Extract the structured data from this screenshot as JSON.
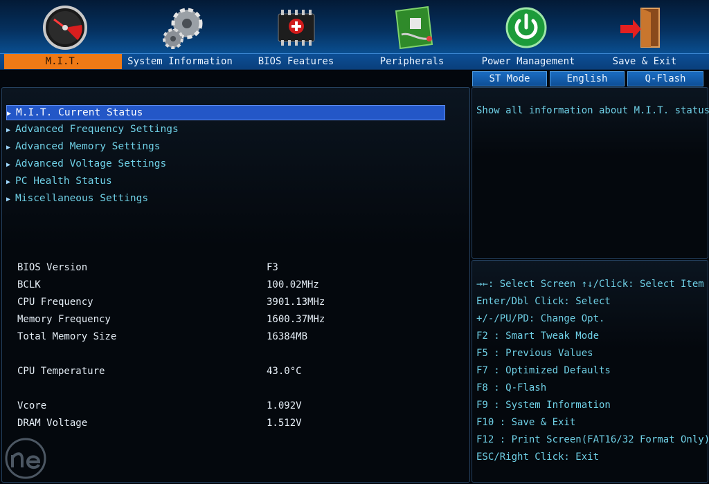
{
  "tabs": [
    {
      "label": "M.I.T.",
      "active": true
    },
    {
      "label": "System Information"
    },
    {
      "label": "BIOS Features"
    },
    {
      "label": "Peripherals"
    },
    {
      "label": "Power Management"
    },
    {
      "label": "Save & Exit"
    }
  ],
  "top_icons": [
    "speedometer-icon",
    "gears-icon",
    "chip-icon",
    "circuit-board-icon",
    "power-icon",
    "exit-door-icon"
  ],
  "modes": [
    "ST Mode",
    "English",
    "Q-Flash"
  ],
  "menu": [
    {
      "label": "M.I.T. Current Status",
      "selected": true
    },
    {
      "label": "Advanced Frequency Settings"
    },
    {
      "label": "Advanced Memory Settings"
    },
    {
      "label": "Advanced Voltage Settings"
    },
    {
      "label": "PC Health Status"
    },
    {
      "label": "Miscellaneous Settings"
    }
  ],
  "info": [
    {
      "label": "BIOS Version",
      "value": "F3"
    },
    {
      "label": "BCLK",
      "value": "100.02MHz"
    },
    {
      "label": "CPU Frequency",
      "value": "3901.13MHz"
    },
    {
      "label": "Memory Frequency",
      "value": "1600.37MHz"
    },
    {
      "label": "Total Memory Size",
      "value": "16384MB"
    },
    {
      "label": "CPU Temperature",
      "value": "43.0°C"
    },
    {
      "label": "Vcore",
      "value": "1.092V"
    },
    {
      "label": "DRAM Voltage",
      "value": "1.512V"
    }
  ],
  "help": "Show all information about M.I.T. status",
  "keys": [
    "→←: Select Screen  ↑↓/Click: Select Item",
    "Enter/Dbl Click: Select",
    "+/-/PU/PD: Change Opt.",
    "F2  : Smart Tweak Mode",
    "F5  : Previous Values",
    "F7  : Optimized Defaults",
    "F8  : Q-Flash",
    "F9  : System Information",
    "F10 : Save & Exit",
    "F12 : Print Screen(FAT16/32 Format Only)",
    "ESC/Right Click: Exit"
  ],
  "colors": {
    "accent_tab": "#ef7a16",
    "selection": "#2357c7",
    "menu_text": "#6fd0e6"
  }
}
